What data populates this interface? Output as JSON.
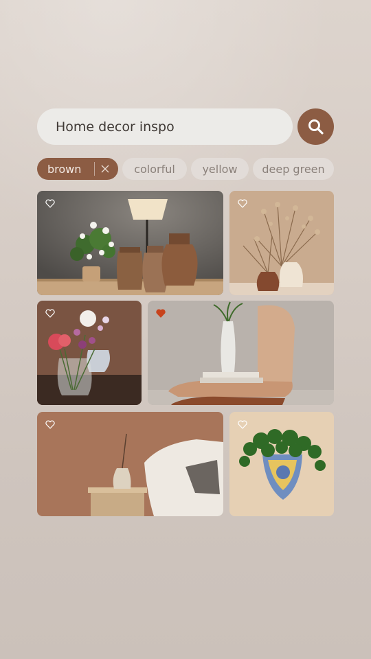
{
  "search": {
    "value": "Home decor inspo"
  },
  "filters": {
    "chips": [
      {
        "label": "brown",
        "selected": true
      },
      {
        "label": "colorful",
        "selected": false
      },
      {
        "label": "yellow",
        "selected": false
      },
      {
        "label": "deep green",
        "selected": false
      }
    ]
  },
  "results": [
    {
      "subject": "flowers, lamp and wooden vases",
      "liked": false
    },
    {
      "subject": "dried flowers in vases",
      "liked": false
    },
    {
      "subject": "flowers in glass vase",
      "liked": false
    },
    {
      "subject": "vase on wooden chair",
      "liked": true
    },
    {
      "subject": "blanket on armchair",
      "liked": false
    },
    {
      "subject": "plant in wall planter",
      "liked": false
    }
  ],
  "colors": {
    "accent": "#8c5c43",
    "heart_liked": "#c8431c",
    "heart_empty": "#ffffff"
  }
}
